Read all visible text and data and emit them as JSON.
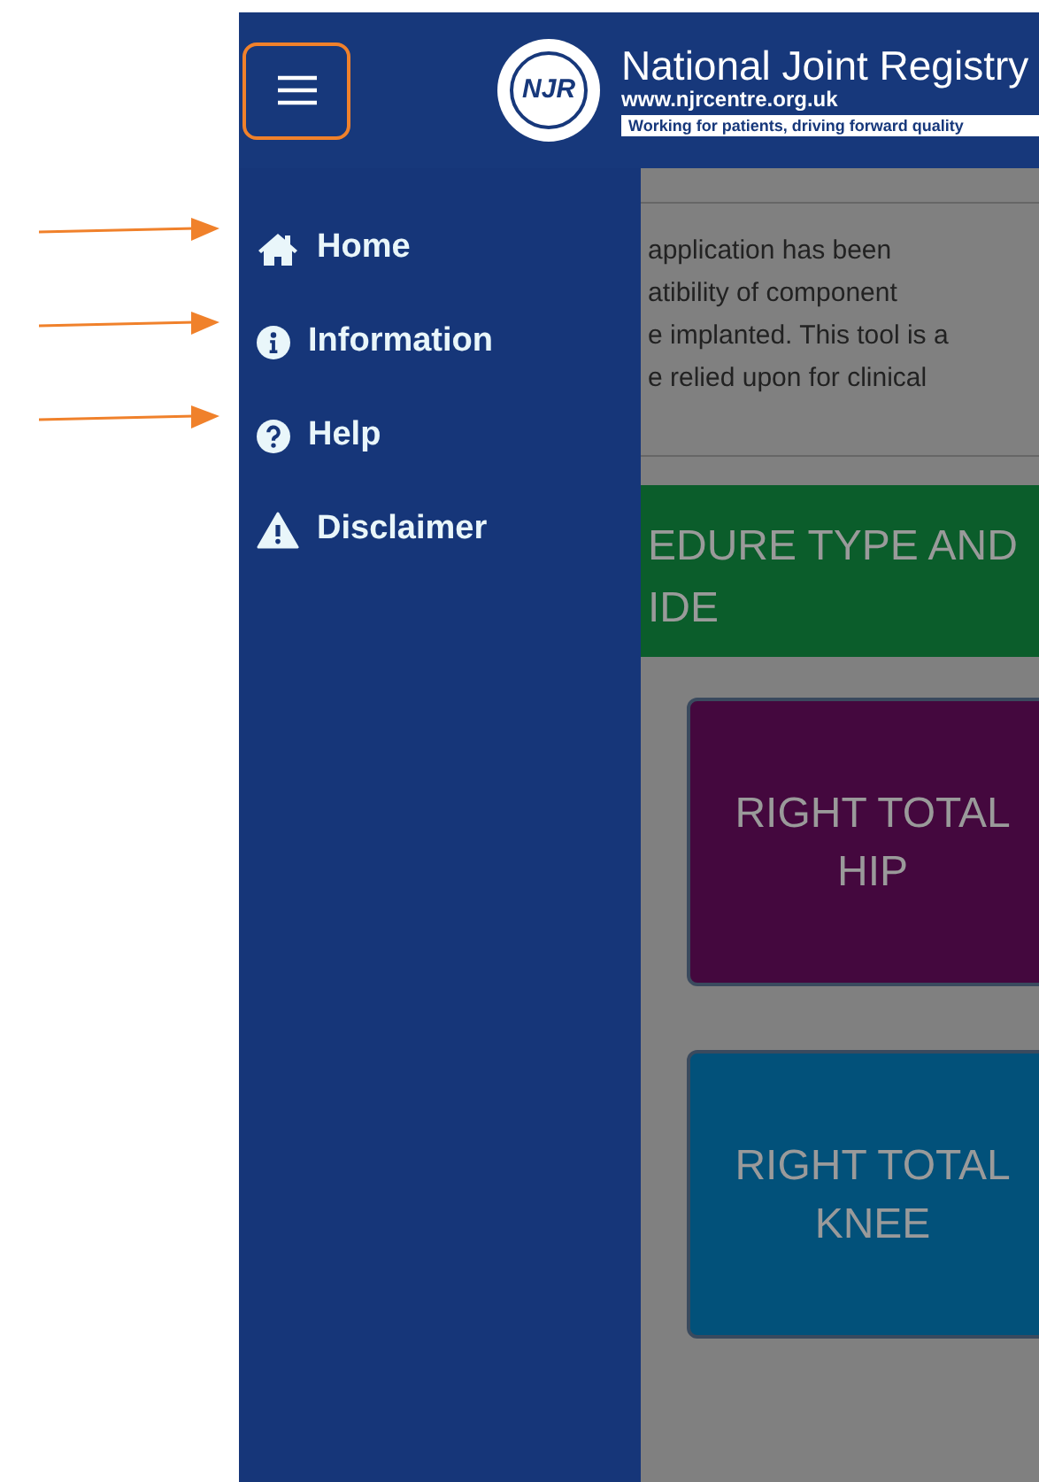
{
  "header": {
    "menu_button": {
      "annotated": true
    },
    "logo_text": "NJR",
    "title": "National Joint Registry",
    "url": "www.njrcentre.org.uk",
    "tagline": "Working for patients, driving forward quality"
  },
  "menu_items": [
    {
      "label": "Home",
      "annotated": true
    },
    {
      "label": "Information",
      "annotated": true
    },
    {
      "label": "Help",
      "annotated": true
    },
    {
      "label": "Disclaimer",
      "annotated": false
    }
  ],
  "notice_lines": [
    "application has been",
    "atibility of component",
    "e implanted. This tool is a",
    "e relied upon for clinical"
  ],
  "banner_lines": [
    "EDURE TYPE AND",
    "IDE"
  ],
  "tiles": [
    {
      "label": "RIGHT TOTAL HIP",
      "color": "#44083e"
    },
    {
      "label": "RIGHT TOTAL KNEE",
      "color": "#02517a"
    }
  ]
}
